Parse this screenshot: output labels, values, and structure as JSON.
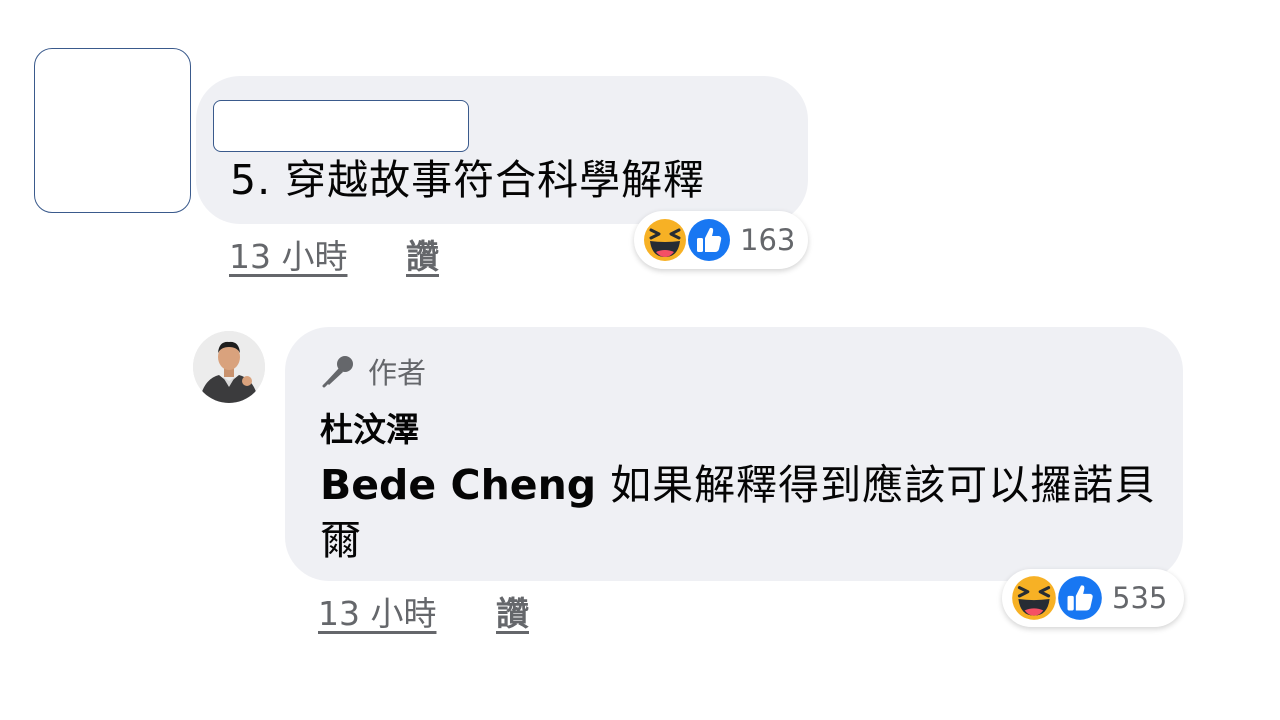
{
  "comments": [
    {
      "text": "5. 穿越故事符合科學解釋",
      "time": "13 小時",
      "like_label": "讚",
      "reaction_count": "163",
      "reactions": [
        "haha-icon",
        "like-icon"
      ]
    }
  ],
  "reply": {
    "badge_label": "作者",
    "author": "杜汶澤",
    "mention": "Bede Cheng",
    "text": "如果解釋得到應該可以攞諾貝爾",
    "time": "13 小時",
    "like_label": "讚",
    "reaction_count": "535",
    "reactions": [
      "haha-icon",
      "like-icon"
    ]
  },
  "colors": {
    "bubble": "#eff0f4",
    "meta_text": "#65676b",
    "like_blue": "#1877f2",
    "haha_yellow": "#f7b125"
  }
}
